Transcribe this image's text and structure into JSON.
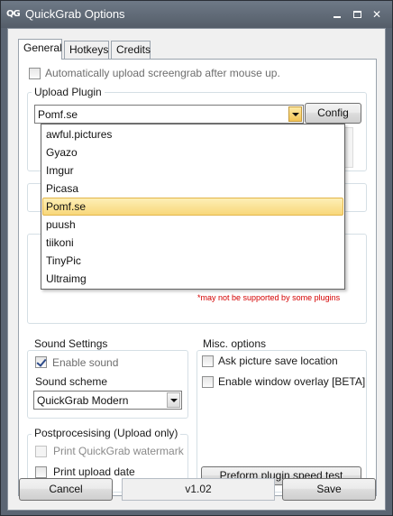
{
  "window": {
    "logo": "QG",
    "title": "QuickGrab Options"
  },
  "tabs": [
    {
      "label": "General"
    },
    {
      "label": "Hotkeys"
    },
    {
      "label": "Credits"
    }
  ],
  "general": {
    "auto_upload_label": "Automatically upload screengrab after mouse up.",
    "upload_plugin": {
      "title": "Upload Plugin",
      "selected": "Pomf.se",
      "config_label": "Config",
      "options": [
        "awful.pictures",
        "Gyazo",
        "Imgur",
        "Picasa",
        "Pomf.se",
        "puush",
        "tiikoni",
        "TinyPic",
        "Ultraimg"
      ]
    },
    "note": "*may not be supported by some plugins",
    "sound": {
      "title": "Sound Settings",
      "enable_label": "Enable sound",
      "scheme_label": "Sound scheme",
      "scheme_value": "QuickGrab Modern"
    },
    "misc": {
      "title": "Misc. options",
      "ask_save_label": "Ask picture save location",
      "overlay_label": "Enable window overlay [BETA]",
      "speed_test_label": "Preform plugin speed test"
    },
    "post": {
      "title": "Postprocesising (Upload only)",
      "watermark_label": "Print QuickGrab watermark",
      "date_label": "Print upload date"
    }
  },
  "footer": {
    "cancel_label": "Cancel",
    "version": "v1.02",
    "save_label": "Save"
  }
}
